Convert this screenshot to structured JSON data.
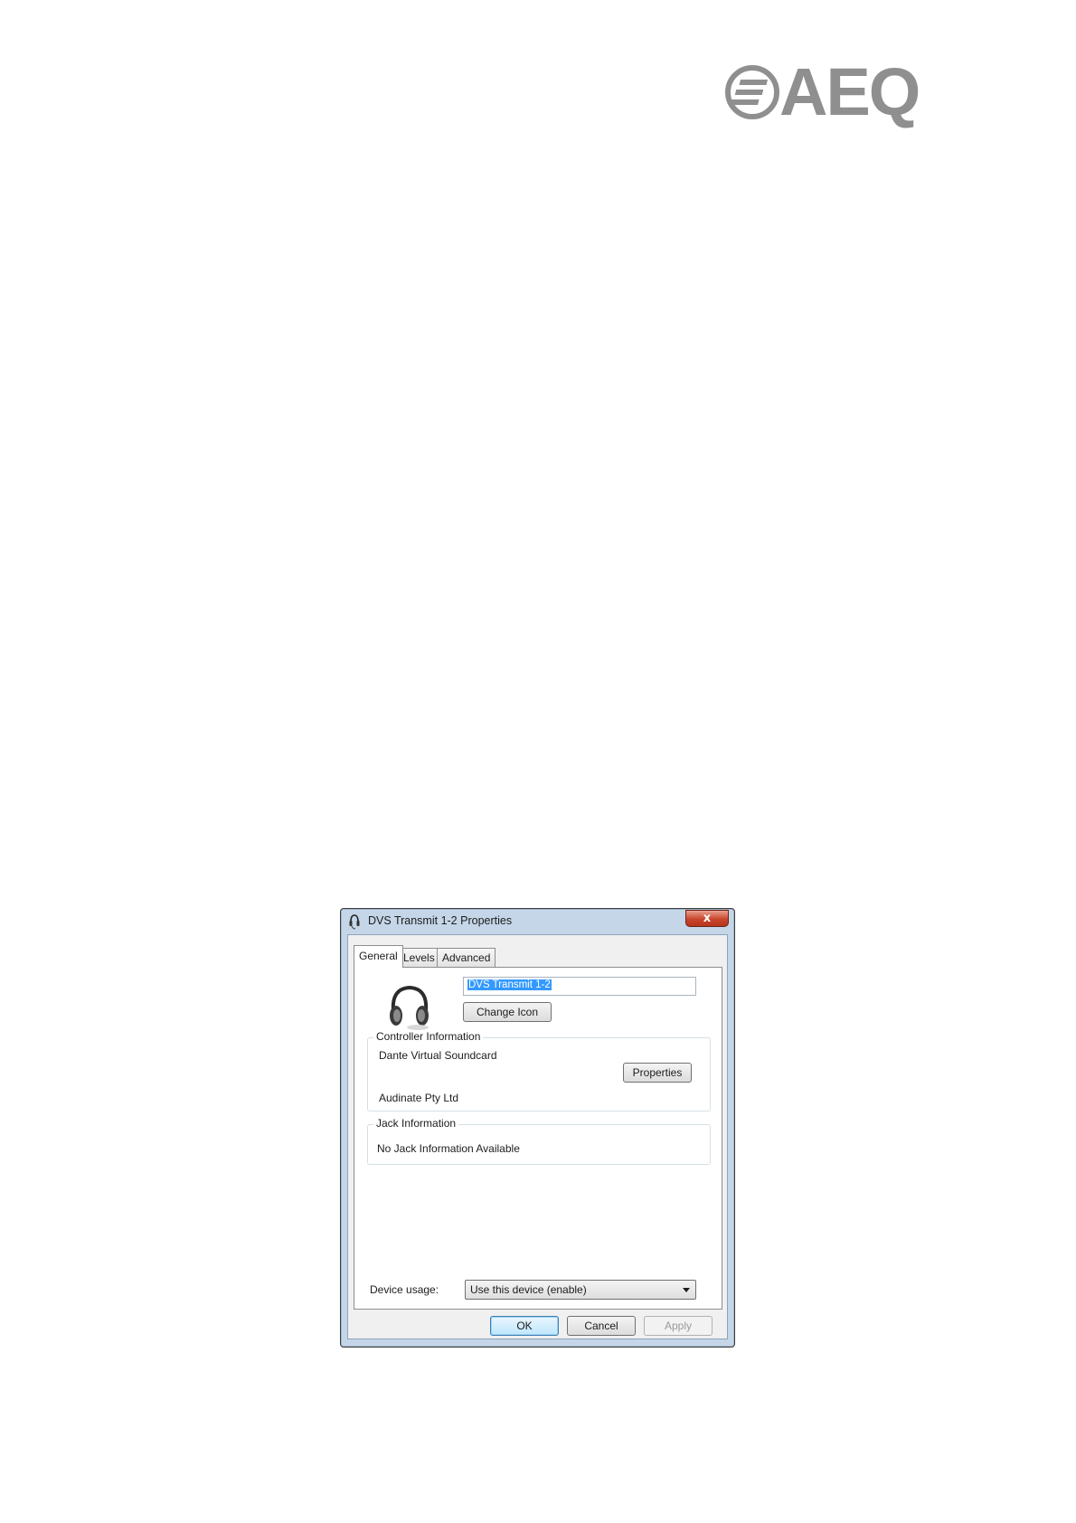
{
  "logo": {
    "text": "AEQ",
    "color": "#8f8f8f"
  },
  "window": {
    "title": "DVS Transmit 1-2 Properties",
    "close_label": "x",
    "title_icon": "headset-icon",
    "close_color": "#c9462c"
  },
  "tabs": [
    {
      "label": "General",
      "active": true
    },
    {
      "label": "Levels",
      "active": false
    },
    {
      "label": "Advanced",
      "active": false
    }
  ],
  "general": {
    "device_icon": "headphones-icon",
    "name_value": "DVS Transmit 1-2",
    "change_icon_label": "Change Icon",
    "controller": {
      "title": "Controller Information",
      "name": "Dante Virtual Soundcard",
      "properties_label": "Properties",
      "vendor": "Audinate Pty Ltd"
    },
    "jack": {
      "title": "Jack Information",
      "text": "No Jack Information Available"
    },
    "device_usage": {
      "label": "Device usage:",
      "selected": "Use this device (enable)"
    }
  },
  "buttons": {
    "ok": "OK",
    "cancel": "Cancel",
    "apply": "Apply"
  },
  "colors": {
    "selection": "#3399ff",
    "frame": "#c5d6e8"
  }
}
